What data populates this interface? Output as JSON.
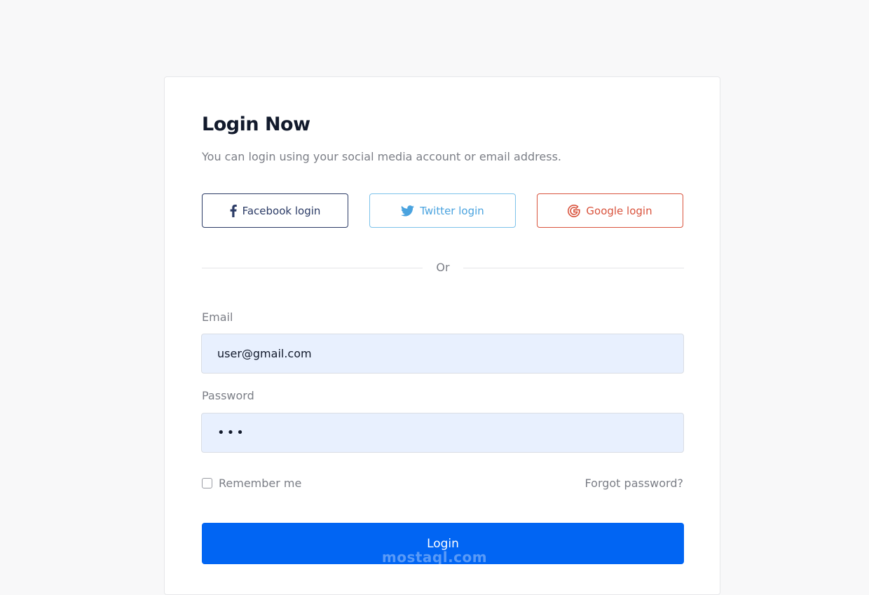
{
  "login": {
    "title": "Login Now",
    "subtitle": "You can login using your social media account or email address.",
    "social": {
      "facebook": {
        "label": "Facebook login",
        "icon": "facebook-icon",
        "color": "#2b3b66"
      },
      "twitter": {
        "label": "Twitter login",
        "icon": "twitter-icon",
        "color": "#4aa3df"
      },
      "google": {
        "label": "Google login",
        "icon": "google-icon",
        "color": "#d9533d"
      }
    },
    "divider_text": "Or",
    "email": {
      "label": "Email",
      "value": "user@gmail.com"
    },
    "password": {
      "label": "Password",
      "value": "•••"
    },
    "remember_label": "Remember me",
    "forgot_label": "Forgot password?",
    "submit_label": "Login"
  },
  "theme": {
    "accent": "#0165f3",
    "input_bg": "#e8f0fe"
  },
  "watermark": {
    "text": "mostaql.com"
  }
}
